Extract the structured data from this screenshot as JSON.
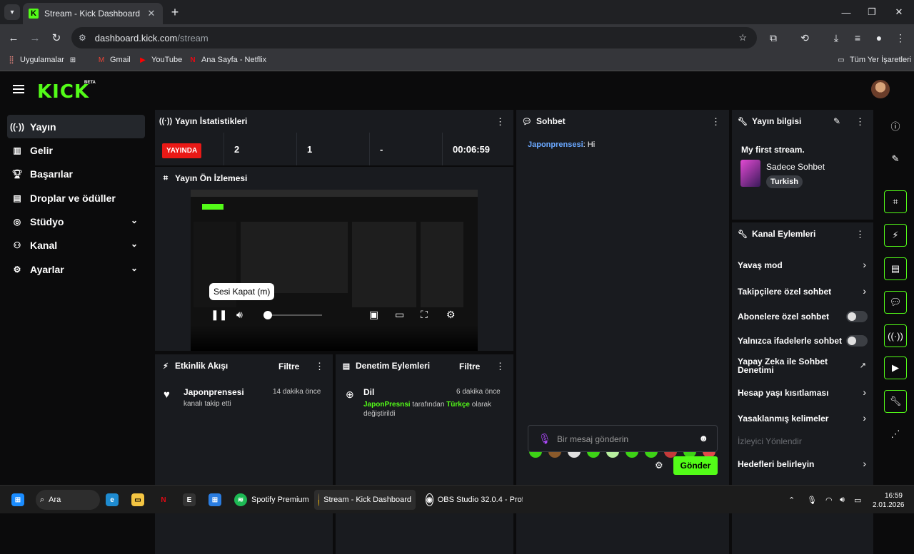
{
  "browser": {
    "tab_title": "Stream - Kick Dashboard",
    "url_host": "dashboard.kick.com",
    "url_path": "/stream",
    "bookmarks": [
      "Uygulamalar",
      "Gmail",
      "YouTube",
      "Ana Sayfa - Netflix"
    ],
    "all_bookmarks": "Tüm Yer İşaretleri"
  },
  "header": {
    "logo": "KICK",
    "beta": "BETA"
  },
  "sidebar": {
    "items": [
      {
        "label": "Yayın",
        "icon": "broadcast-icon"
      },
      {
        "label": "Gelir",
        "icon": "chart-icon"
      },
      {
        "label": "Başarılar",
        "icon": "trophy-icon"
      },
      {
        "label": "Droplar ve ödüller",
        "icon": "gift-icon"
      },
      {
        "label": "Stüdyo",
        "icon": "studio-icon"
      },
      {
        "label": "Kanal",
        "icon": "users-icon"
      },
      {
        "label": "Ayarlar",
        "icon": "gear-icon"
      }
    ]
  },
  "stats": {
    "title": "Yayın İstatistikleri",
    "live": "YAYINDA",
    "viewers": "2",
    "followers": "1",
    "other": "-",
    "duration": "00:06:59"
  },
  "preview": {
    "title": "Yayın Ön İzlemesi",
    "tooltip": "Sesi Kapat (m)"
  },
  "activity": {
    "title": "Etkinlik Akışı",
    "filter": "Filtre",
    "user": "Japonprensesi",
    "time": "14 dakika önce",
    "action": "kanalı takip etti"
  },
  "moderation": {
    "title": "Denetim Eylemleri",
    "filter": "Filtre",
    "heading": "Dil",
    "time": "6 dakika önce",
    "who": "JaponPresnsi",
    "text1": " tarafından ",
    "lang": "Türkçe",
    "text2": " olarak",
    "text3": "değiştirildi"
  },
  "chat": {
    "title": "Sohbet",
    "message_user": "Japonprensesi",
    "message_text": ": Hi",
    "placeholder": "Bir mesaj gönderin",
    "send": "Gönder"
  },
  "stream_info": {
    "title": "Yayın bilgisi",
    "stream_title": "My first stream.",
    "category": "Sadece Sohbet",
    "tag": "Turkish"
  },
  "channel_actions": {
    "title": "Kanal Eylemleri",
    "items": [
      {
        "label": "Yavaş mod"
      },
      {
        "label": "Takipçilere özel sohbet"
      },
      {
        "label": "Abonelere özel sohbet"
      },
      {
        "label": "Yalnızca ifadelerle sohbet"
      },
      {
        "label": "Yapay Zeka ile Sohbet Denetimi"
      },
      {
        "label": "Hesap yaşı kısıtlaması"
      },
      {
        "label": "Yasaklanmış kelimeler"
      },
      {
        "label": "İzleyici Yönlendir"
      },
      {
        "label": "Hedefleri belirleyin"
      }
    ]
  },
  "taskbar": {
    "search": "Ara",
    "apps": [
      "Spotify Premium",
      "Stream - Kick Dashboard",
      "OBS Studio 32.0.4 - Prof"
    ],
    "time": "16:59",
    "date": "2.01.2026"
  },
  "colors": {
    "brand": "#53fc18",
    "live": "#e91916",
    "panel": "#191b1f"
  }
}
